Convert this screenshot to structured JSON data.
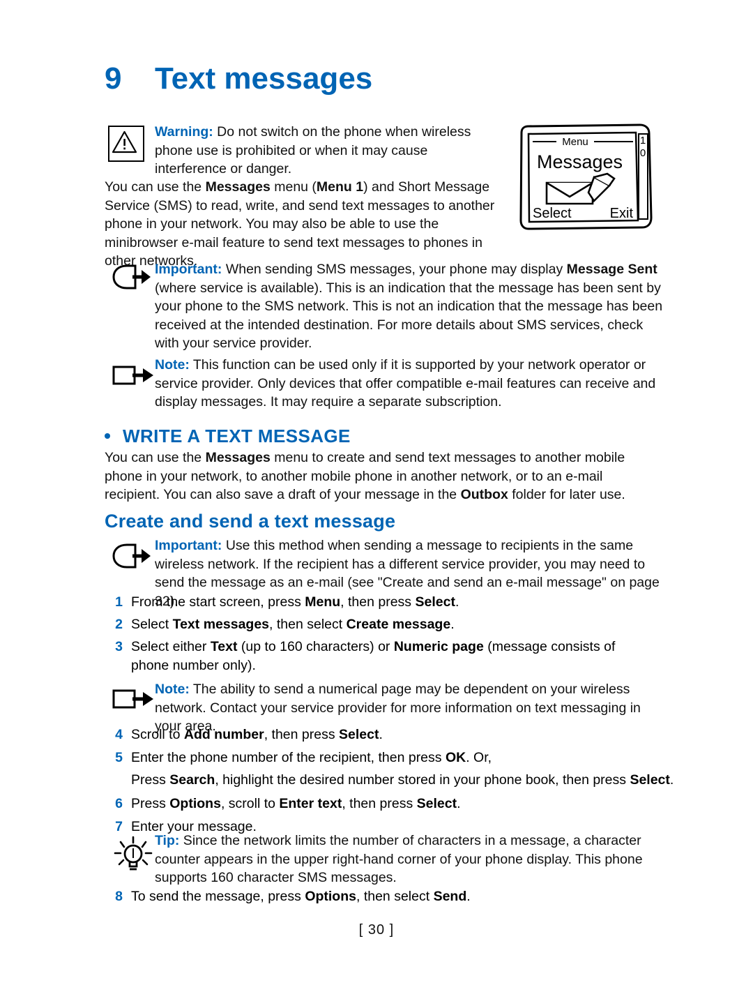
{
  "chapter": {
    "number": "9",
    "title": "Text messages"
  },
  "warning": {
    "label": "Warning:",
    "text": " Do not switch on the phone when wireless phone use is prohibited or when it may cause interference or danger."
  },
  "intro": {
    "p1_a": "You can use the ",
    "p1_b": "Messages",
    "p1_c": " menu (",
    "p1_d": "Menu 1",
    "p1_e": ") and Short Message Service (SMS) to read, write, and send text messages to another phone in your network. You may also be able to use the minibrowser e-mail feature to send text messages to phones in other networks."
  },
  "important1": {
    "label": "Important:",
    "text_a": " When sending SMS messages, your phone may display ",
    "bold_a": "Message Sent",
    "text_b": " (where service is available). This is an indication that the message has been sent by your phone to the SMS network. This is not an indication that the message has been received at the intended destination. For more details about SMS services, check with your service provider."
  },
  "note1": {
    "label": "Note:",
    "text": " This function can be used only if it is supported by your network operator or service provider. Only devices that offer compatible e-mail features can receive and display messages. It may require a separate subscription."
  },
  "section": {
    "heading": "WRITE A TEXT MESSAGE",
    "body_a": "You can use the ",
    "body_bold1": "Messages",
    "body_b": " menu to create and send text messages to another mobile phone in your network, to another mobile phone in another network, or to an e-mail recipient. You can also save a draft of your message in the ",
    "body_bold2": "Outbox",
    "body_c": " folder for later use.",
    "subheading": "Create and send a text message"
  },
  "important2": {
    "label": "Important:",
    "text": " Use this method when sending a message to recipients in the same wireless network. If the recipient has a different service provider, you may need to send the message as an e-mail (see \"Create and send an e-mail message\" on page 32)."
  },
  "steps": [
    {
      "n": "1",
      "parts": [
        {
          "t": "From the start screen, press ",
          "b": false
        },
        {
          "t": "Menu",
          "b": true
        },
        {
          "t": ", then press ",
          "b": false
        },
        {
          "t": "Select",
          "b": true
        },
        {
          "t": ".",
          "b": false
        }
      ]
    },
    {
      "n": "2",
      "parts": [
        {
          "t": "Select ",
          "b": false
        },
        {
          "t": "Text messages",
          "b": true
        },
        {
          "t": ", then select ",
          "b": false
        },
        {
          "t": "Create message",
          "b": true
        },
        {
          "t": ".",
          "b": false
        }
      ]
    },
    {
      "n": "3",
      "parts": [
        {
          "t": "Select either ",
          "b": false
        },
        {
          "t": "Text",
          "b": true
        },
        {
          "t": " (up to 160 characters) or ",
          "b": false
        },
        {
          "t": "Numeric page",
          "b": true
        },
        {
          "t": " (message consists of phone number only).",
          "b": false
        }
      ]
    },
    {
      "n": "4",
      "parts": [
        {
          "t": "Scroll to ",
          "b": false
        },
        {
          "t": "Add number",
          "b": true
        },
        {
          "t": ", then press ",
          "b": false
        },
        {
          "t": "Select",
          "b": true
        },
        {
          "t": ".",
          "b": false
        }
      ]
    },
    {
      "n": "5",
      "parts": [
        {
          "t": "Enter the phone number of the recipient, then press ",
          "b": false
        },
        {
          "t": "OK",
          "b": true
        },
        {
          "t": ". Or,",
          "b": false
        }
      ]
    },
    {
      "n": "",
      "parts": [
        {
          "t": "Press ",
          "b": false
        },
        {
          "t": "Search",
          "b": true
        },
        {
          "t": ", highlight the desired number stored in your phone book, then press ",
          "b": false
        },
        {
          "t": "Select",
          "b": true
        },
        {
          "t": ".",
          "b": false
        }
      ]
    },
    {
      "n": "6",
      "parts": [
        {
          "t": "Press ",
          "b": false
        },
        {
          "t": "Options",
          "b": true
        },
        {
          "t": ", scroll to ",
          "b": false
        },
        {
          "t": "Enter text",
          "b": true
        },
        {
          "t": ", then press ",
          "b": false
        },
        {
          "t": "Select",
          "b": true
        },
        {
          "t": ".",
          "b": false
        }
      ]
    },
    {
      "n": "7",
      "parts": [
        {
          "t": "Enter your message.",
          "b": false
        }
      ]
    },
    {
      "n": "8",
      "parts": [
        {
          "t": "To send the message, press ",
          "b": false
        },
        {
          "t": "Options",
          "b": true
        },
        {
          "t": ", then select ",
          "b": false
        },
        {
          "t": "Send",
          "b": true
        },
        {
          "t": ".",
          "b": false
        }
      ]
    }
  ],
  "note2": {
    "label": "Note:",
    "text": " The ability to send a numerical page may be dependent on your wireless network. Contact your service provider for more information on text messaging in your area."
  },
  "tip": {
    "label": "Tip:",
    "text": " Since the network limits the number of characters in a message, a character counter appears in the upper right-hand corner of your phone display. This phone supports 160 character SMS messages."
  },
  "phone_screen": {
    "soft_top": "Menu",
    "indicator_1": "1",
    "indicator_2": "0",
    "title": "Messages",
    "soft_left": "Select",
    "soft_right": "Exit"
  },
  "footer": {
    "text": "[ 30 ]"
  },
  "colors": {
    "accent": "#0064b4",
    "text": "#111111"
  }
}
